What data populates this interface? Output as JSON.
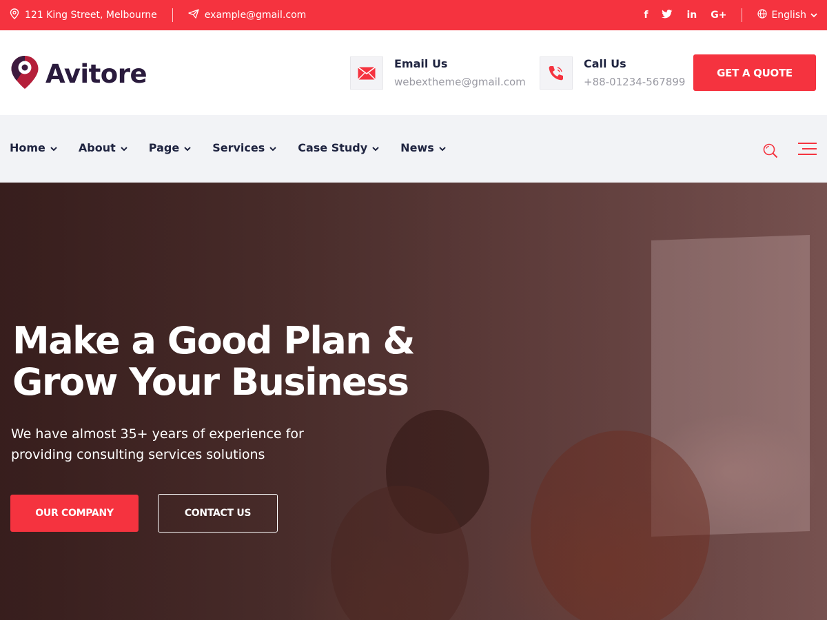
{
  "topbar": {
    "address": "121 King Street, Melbourne",
    "email": "example@gmail.com",
    "social": [
      "f",
      "t",
      "in",
      "G+"
    ],
    "language": "English"
  },
  "header": {
    "logo_text": "Avitore",
    "email": {
      "title": "Email Us",
      "value": "webextheme@gmail.com"
    },
    "phone": {
      "title": "Call Us",
      "value": "+88-01234-567899"
    },
    "quote_label": "GET A QUOTE"
  },
  "nav": {
    "items": [
      {
        "label": "Home"
      },
      {
        "label": "About"
      },
      {
        "label": "Page"
      },
      {
        "label": "Services"
      },
      {
        "label": "Case Study"
      },
      {
        "label": "News"
      }
    ]
  },
  "hero": {
    "title_line1": "Make a Good Plan &",
    "title_line2": "Grow Your Business",
    "subtitle_line1": "We have almost 35+ years of experience for",
    "subtitle_line2": "providing consulting services solutions",
    "primary_button": "OUR COMPANY",
    "secondary_button": "CONTACT US"
  },
  "colors": {
    "accent": "#f5333f",
    "dark": "#1f2440",
    "nav_bg": "#f2f3f6"
  },
  "icons": {
    "address": "map-pin-icon",
    "email": "paper-plane-icon",
    "globe": "globe-icon",
    "mail": "envelope-icon",
    "phone": "phone-icon",
    "search": "search-icon",
    "menu": "hamburger-menu-icon"
  }
}
